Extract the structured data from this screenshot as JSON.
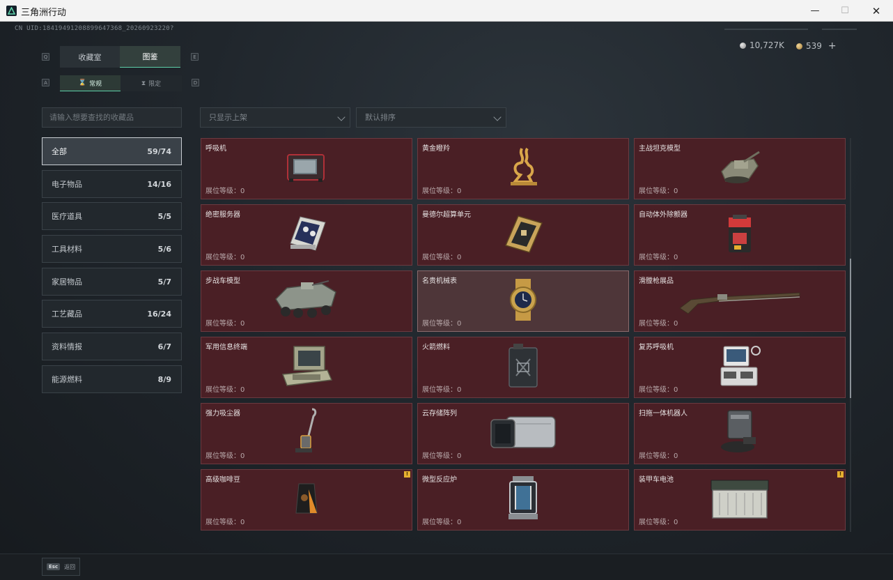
{
  "window": {
    "title": "三角洲行动",
    "minimize": "—",
    "maximize": "☐",
    "close": "✕"
  },
  "uid": "CN UID:18419491208899647368_20260923220?",
  "currency": [
    {
      "icon": "silver-coin-icon",
      "value": "10,727K"
    },
    {
      "icon": "gold-coin-icon",
      "value": "539"
    }
  ],
  "currency_plus": "+",
  "keys": {
    "q": "Q",
    "e": "E",
    "a": "A",
    "d": "D"
  },
  "tabs": [
    {
      "label": "收藏室"
    },
    {
      "label": "图鉴"
    }
  ],
  "subtabs": [
    {
      "label": "常规"
    },
    {
      "label": "限定"
    }
  ],
  "search": {
    "placeholder": "请输入想要查找的收藏品"
  },
  "filters": [
    {
      "value": "只显示上架"
    },
    {
      "value": "默认排序"
    }
  ],
  "categories": [
    {
      "label": "全部",
      "count": "59/74"
    },
    {
      "label": "电子物品",
      "count": "14/16"
    },
    {
      "label": "医疗道具",
      "count": "5/5"
    },
    {
      "label": "工具材料",
      "count": "5/6"
    },
    {
      "label": "家居物品",
      "count": "5/7"
    },
    {
      "label": "工艺藏品",
      "count": "16/24"
    },
    {
      "label": "资料情报",
      "count": "6/7"
    },
    {
      "label": "能源燃料",
      "count": "8/9"
    }
  ],
  "level_label": "展位等级：0",
  "items": [
    {
      "name": "呼吸机",
      "icon": "ventilator-icon"
    },
    {
      "name": "黄金瞪羚",
      "icon": "golden-gazelle-icon"
    },
    {
      "name": "主战坦克模型",
      "icon": "tank-model-icon"
    },
    {
      "name": "绝密服务器",
      "icon": "server-icon"
    },
    {
      "name": "曼德尔超算单元",
      "icon": "supercomputer-unit-icon"
    },
    {
      "name": "自动体外除颤器",
      "icon": "defibrillator-icon"
    },
    {
      "name": "步战车模型",
      "icon": "ifv-model-icon"
    },
    {
      "name": "名贵机械表",
      "icon": "watch-icon"
    },
    {
      "name": "滑膛枪展品",
      "icon": "musket-icon"
    },
    {
      "name": "军用信息终端",
      "icon": "military-terminal-icon"
    },
    {
      "name": "火箭燃料",
      "icon": "rocket-fuel-icon"
    },
    {
      "name": "复苏呼吸机",
      "icon": "resuscitator-icon"
    },
    {
      "name": "强力吸尘器",
      "icon": "vacuum-icon"
    },
    {
      "name": "云存储阵列",
      "icon": "cloud-storage-icon"
    },
    {
      "name": "扫拖一体机器人",
      "icon": "robot-mop-icon"
    },
    {
      "name": "高级咖啡豆",
      "icon": "coffee-bean-icon",
      "badge": "!"
    },
    {
      "name": "微型反应炉",
      "icon": "micro-reactor-icon"
    },
    {
      "name": "装甲车电池",
      "icon": "battery-icon",
      "badge": "!"
    }
  ],
  "footer": {
    "key": "Esc",
    "label": "返回"
  }
}
